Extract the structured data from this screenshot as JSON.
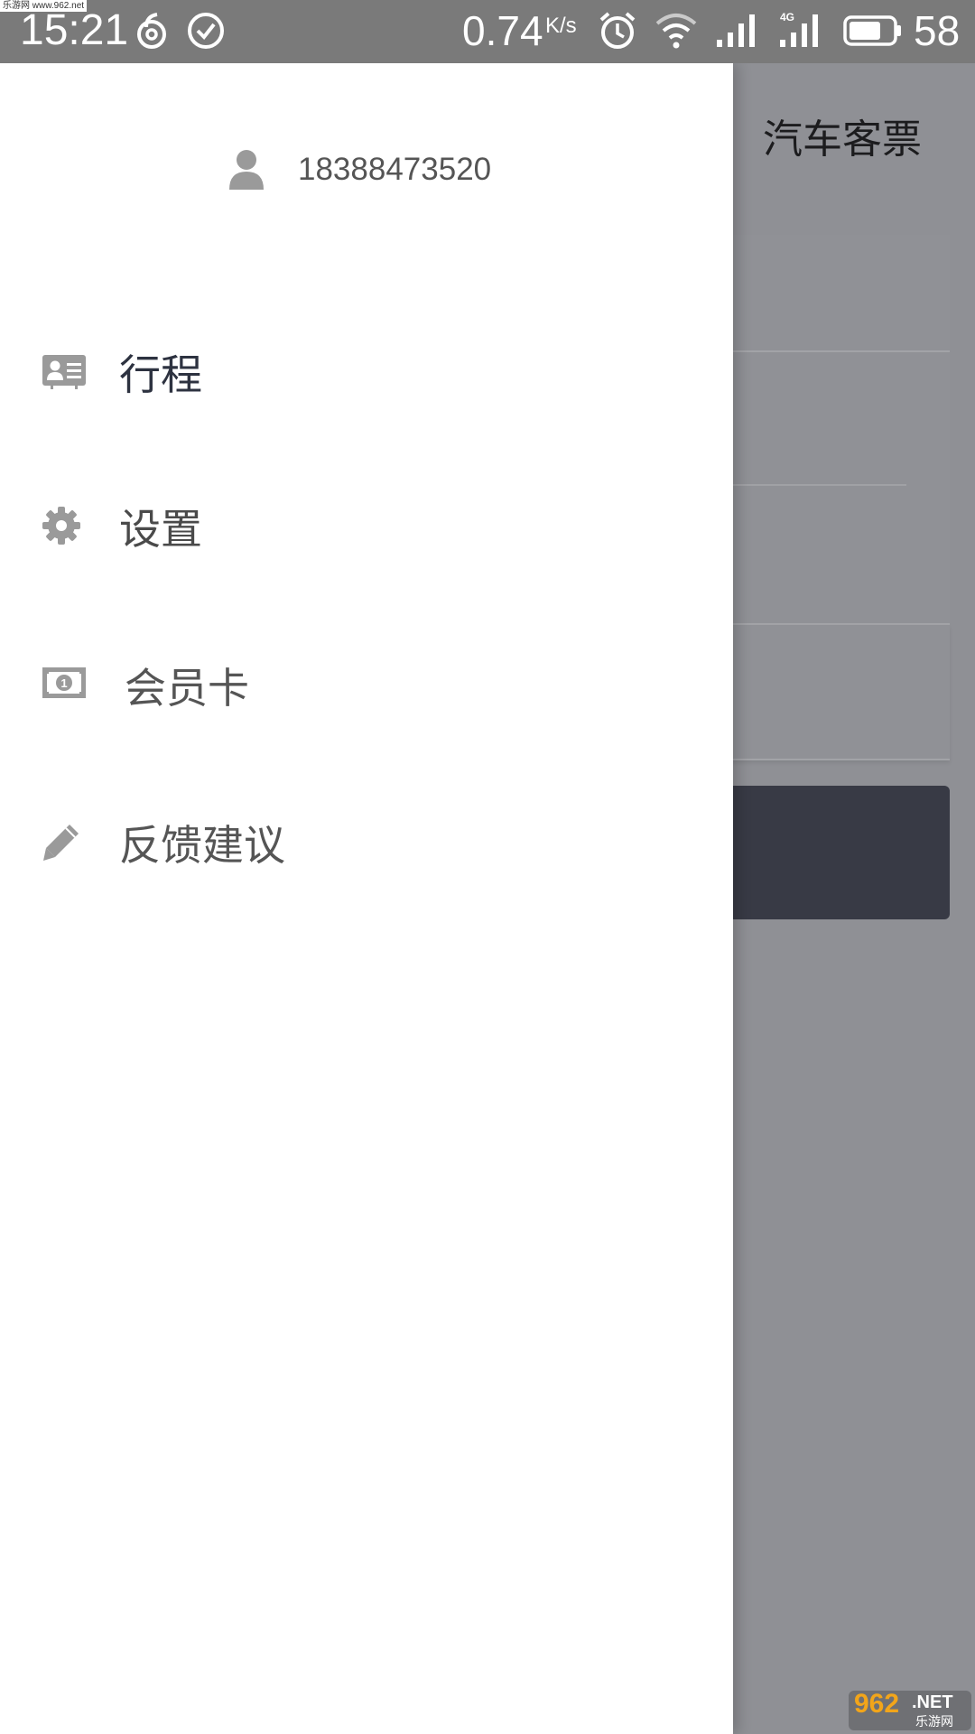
{
  "status_bar": {
    "time": "15:21",
    "speed": "0.74",
    "speed_unit": "K/s",
    "network": "4G",
    "battery": "58",
    "watermark": "乐游网 www.962.net"
  },
  "background": {
    "title": "汽车客票"
  },
  "drawer": {
    "user_phone": "18388473520",
    "menu": [
      {
        "label": "行程",
        "icon": "id-card-icon"
      },
      {
        "label": "设置",
        "icon": "gear-icon"
      },
      {
        "label": "会员卡",
        "icon": "money-bill-icon"
      },
      {
        "label": "反馈建议",
        "icon": "pencil-icon"
      }
    ]
  },
  "logo": {
    "big": "962",
    "net": ".NET",
    "cn": "乐游网"
  },
  "colors": {
    "status_bar": "#7a7a7a",
    "overlay_background": "#8f9095",
    "dark_button": "#383a45",
    "drawer": "#ffffff",
    "icon_gray": "#9a9a9a",
    "logo_orange": "#f2a51a"
  }
}
